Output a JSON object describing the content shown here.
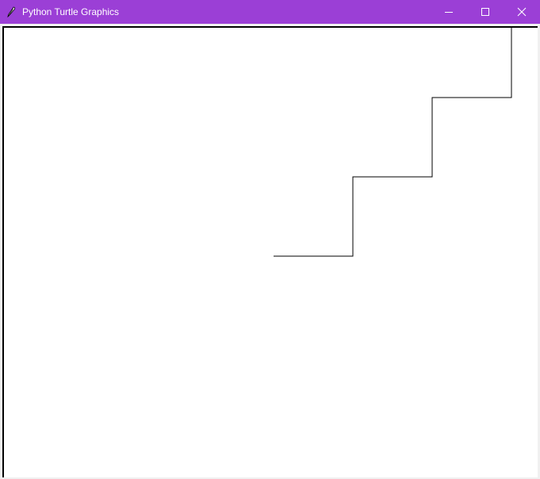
{
  "window": {
    "title": "Python Turtle Graphics",
    "icon": "feather-pen-icon",
    "titlebar_color": "#9b3fd6",
    "controls": {
      "minimize": "minimize-icon",
      "maximize": "maximize-icon",
      "close": "close-icon"
    }
  },
  "canvas": {
    "background": "#ffffff",
    "drawing": {
      "shape": "staircase",
      "steps": 3,
      "stroke_color": "#000000"
    }
  }
}
